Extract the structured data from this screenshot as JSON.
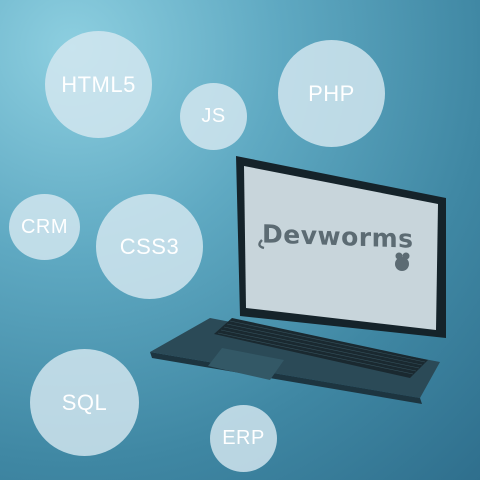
{
  "bubbles": {
    "html5": "HTML5",
    "js": "JS",
    "php": "PHP",
    "crm": "CRM",
    "css3": "CSS3",
    "sql": "SQL",
    "erp": "ERP"
  },
  "screen_logo": {
    "text": "Devworms",
    "icon": "worm-mascot-icon"
  },
  "colors": {
    "background_light": "#8dcfe0",
    "background_dark": "#2f6f8d",
    "bubble_fill": "#d6e8f0",
    "bubble_text": "#ffffff",
    "laptop_body": "#2b4a57",
    "screen": "#c8d5db"
  }
}
